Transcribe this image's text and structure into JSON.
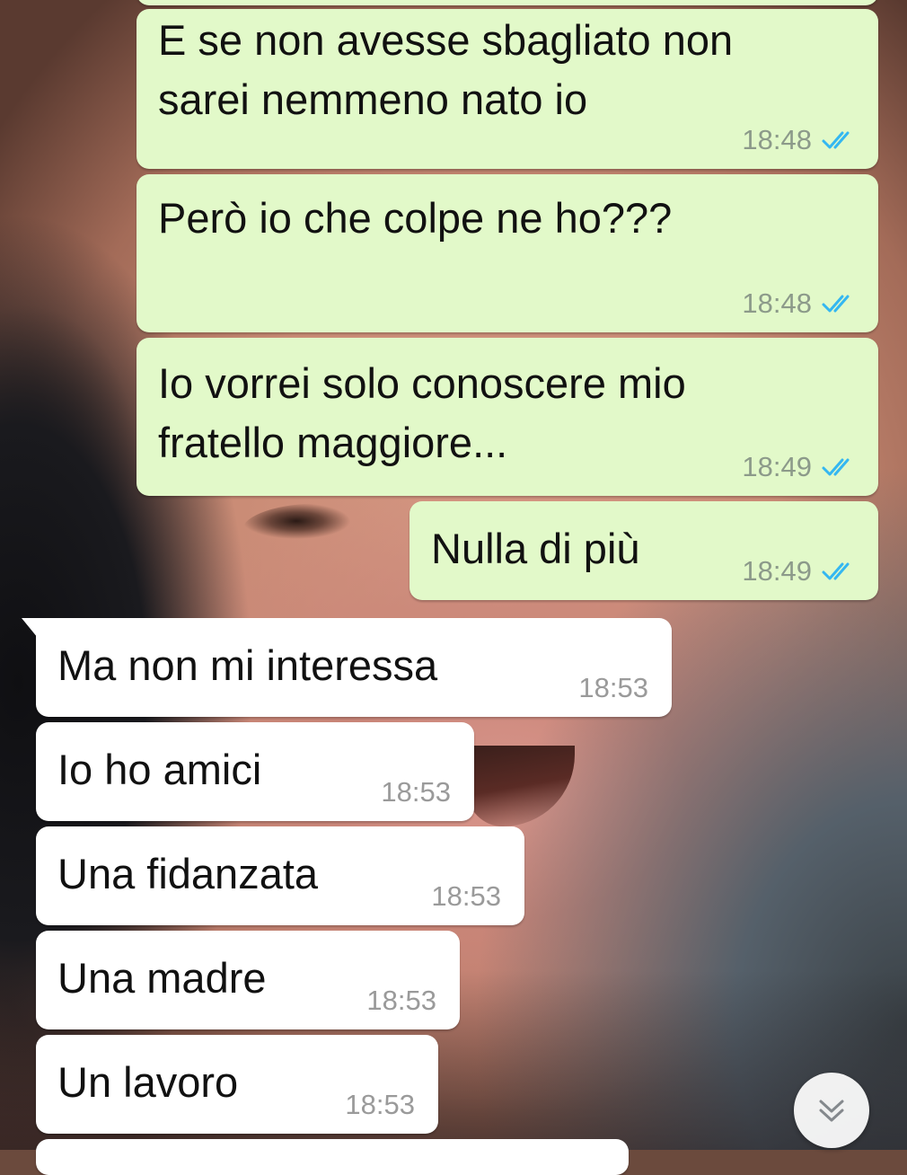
{
  "messages": [
    {
      "dir": "out",
      "text": "E se non avesse sbagliato non\nsarei nemmeno nato io",
      "time": "18:48",
      "status": "read"
    },
    {
      "dir": "out",
      "text": "Però io che colpe ne ho???",
      "time": "18:48",
      "status": "read"
    },
    {
      "dir": "out",
      "text": "Io vorrei solo conoscere mio\nfratello maggiore...",
      "time": "18:49",
      "status": "read"
    },
    {
      "dir": "out",
      "text": "Nulla di più",
      "time": "18:49",
      "status": "read"
    },
    {
      "dir": "in",
      "text": "Ma non mi interessa",
      "time": "18:53"
    },
    {
      "dir": "in",
      "text": "Io ho amici",
      "time": "18:53"
    },
    {
      "dir": "in",
      "text": "Una fidanzata",
      "time": "18:53"
    },
    {
      "dir": "in",
      "text": "Una madre",
      "time": "18:53"
    },
    {
      "dir": "in",
      "text": "Un lavoro",
      "time": "18:53"
    }
  ],
  "colors": {
    "outgoing_bubble": "#e2f9c9",
    "incoming_bubble": "#ffffff",
    "read_ticks": "#34b7f1",
    "timestamp": "#8c9a8a"
  },
  "icons": {
    "read_receipt": "double-check-icon",
    "scroll_down": "chevrons-down-icon"
  }
}
